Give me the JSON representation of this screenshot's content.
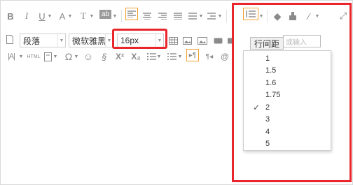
{
  "toolbar": {
    "row1": [
      {
        "name": "bold-icon",
        "glyph": "B"
      },
      {
        "name": "italic-icon",
        "glyph": "I"
      },
      {
        "name": "underline-icon",
        "glyph": "U"
      },
      {
        "name": "font-color-icon",
        "glyph": "A"
      },
      {
        "name": "font-style-icon",
        "glyph": "T"
      },
      {
        "name": "background-color-icon",
        "glyph": "ab"
      }
    ],
    "paragraph_select": "段落",
    "font_family_select": "微软雅黑",
    "font_size_select": "16px",
    "line_height_tooltip": "行间距",
    "line_height_input_placeholder": "或输入"
  },
  "line_height_menu": {
    "options": [
      "1",
      "1.5",
      "1.6",
      "1.75",
      "2",
      "3",
      "4",
      "5"
    ],
    "selected": "2",
    "check": "✓"
  },
  "colors": {
    "highlight_border": "#e8262c",
    "icon": "#8a8a8a",
    "active_icon_border": "#f0a030"
  }
}
